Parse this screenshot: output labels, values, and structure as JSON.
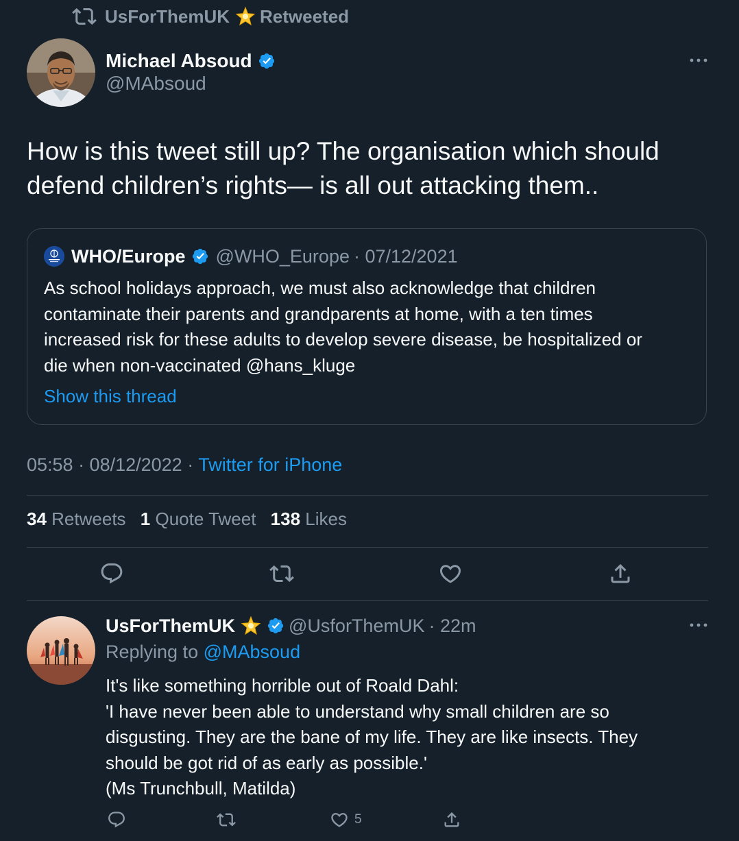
{
  "retweet_header": {
    "account": "UsForThemUK",
    "label": "Retweeted"
  },
  "tweet": {
    "author_name": "Michael Absoud",
    "author_handle": "@MAbsoud",
    "text_line1": "How is this tweet still up? The organisation which should",
    "text_line2": "defend children’s rights— is all out attacking them..",
    "timestamp": "05:58 · 08/12/2022 · ",
    "source": "Twitter for iPhone"
  },
  "quote": {
    "author_name": "WHO/Europe",
    "author_handle": "@WHO_Europe",
    "date": "· 07/12/2021",
    "text_lines": [
      "As school holidays approach, we must also acknowledge that children",
      "contaminate their parents and grandparents at home, with a ten times",
      "increased risk for these adults to develop severe disease, be hospitalized or",
      "die when non-vaccinated @hans_kluge"
    ],
    "show_thread": "Show this thread"
  },
  "stats": {
    "retweets_count": "34",
    "retweets_label": "Retweets",
    "quotes_count": "1",
    "quotes_label": "Quote Tweet",
    "likes_count": "138",
    "likes_label": "Likes"
  },
  "reply": {
    "author_name": "UsForThemUK",
    "author_handle": "@UsforThemUK",
    "time": "· 22m",
    "replying_prefix": "Replying to",
    "replying_handle": "@MAbsoud",
    "text_lines": [
      "It's like something horrible out of Roald Dahl:",
      "'I have never been able to understand why small children are so",
      "disgusting. They are the bane of my life. They are like insects. They",
      "should be got rid of as early as possible.'",
      "(Ms Trunchbull, Matilda)"
    ],
    "like_count": "5"
  },
  "colors": {
    "background": "#15202b",
    "accent": "#1d9bf0",
    "muted": "#8b98a5",
    "border": "#38444d"
  },
  "icons": {
    "retweet": "retweet-icon",
    "star": "star-icon",
    "verified": "verified-badge-icon",
    "more": "more-dots-icon",
    "reply": "reply-icon",
    "like": "heart-icon",
    "share": "share-icon"
  }
}
